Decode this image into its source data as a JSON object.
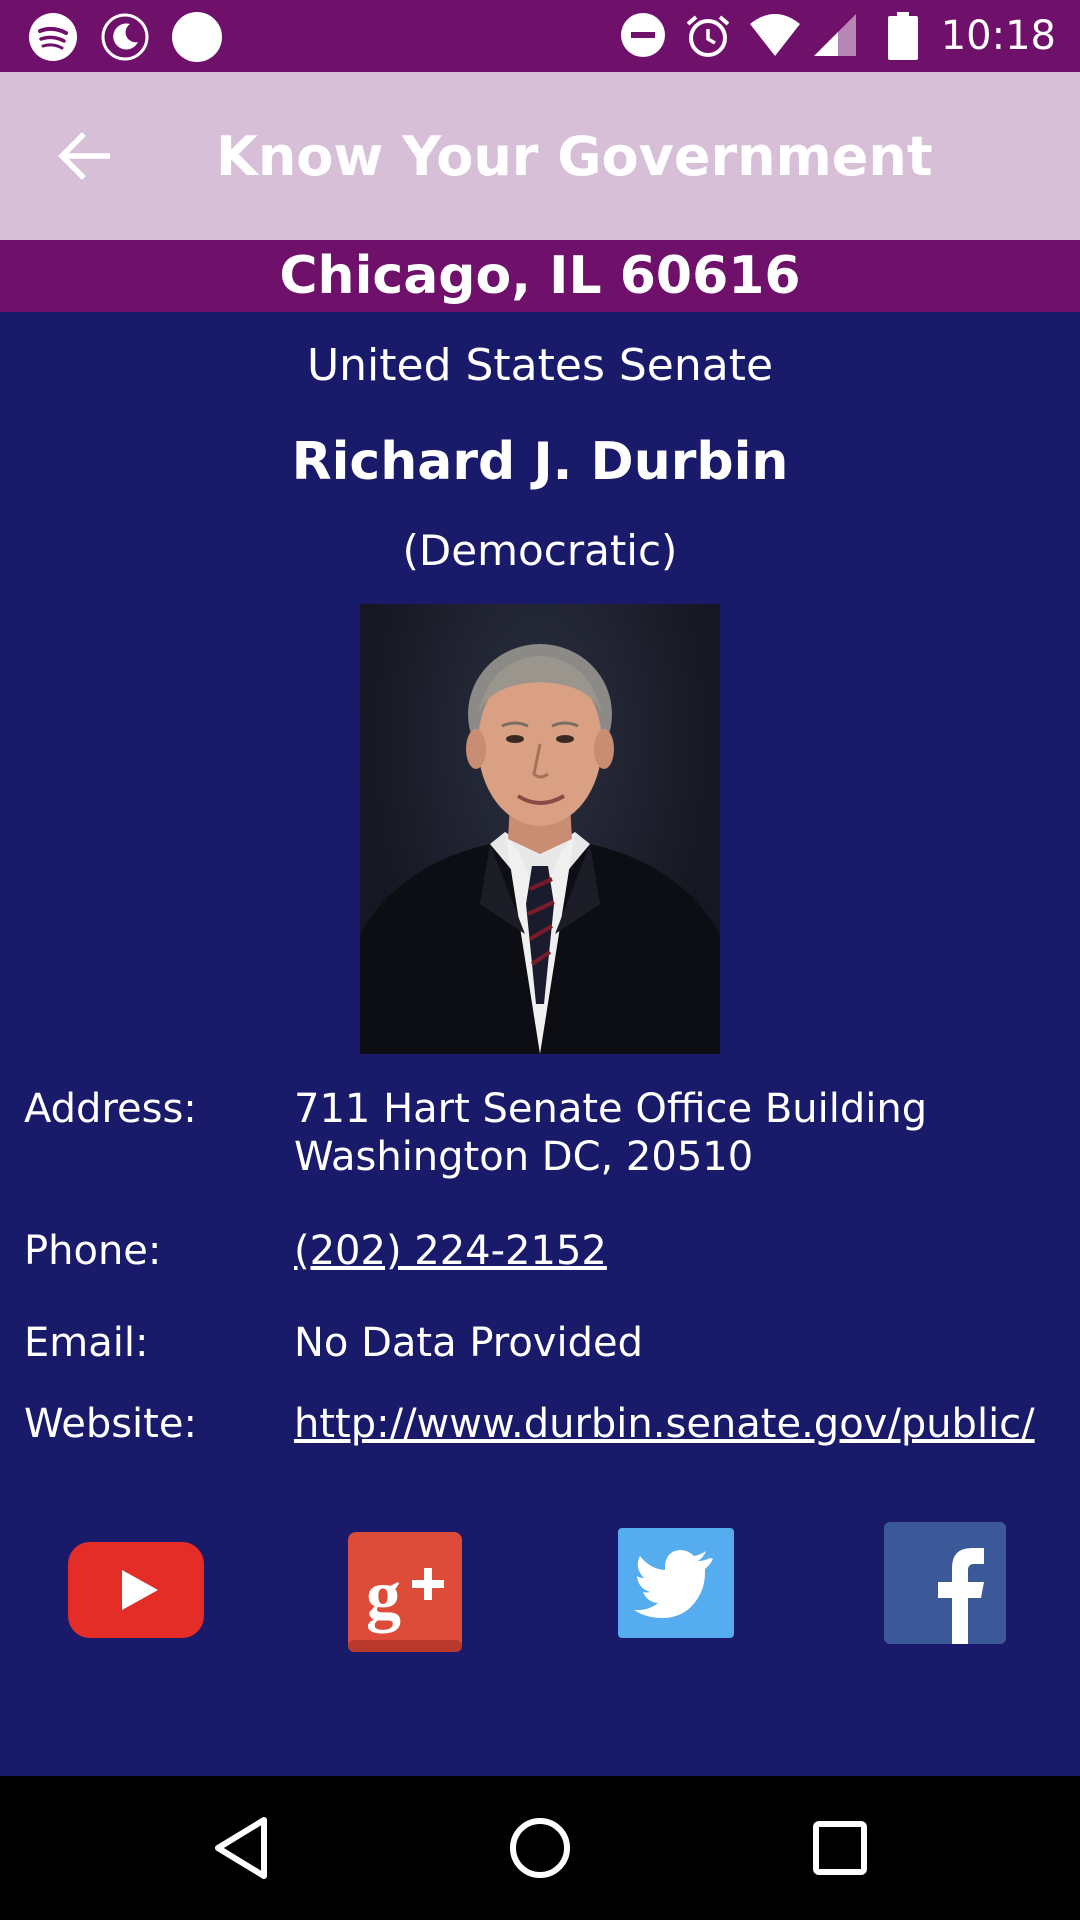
{
  "status_bar": {
    "time": "10:18",
    "left_icons": [
      "spotify-icon",
      "night-mode-icon",
      "circle-notification-icon"
    ],
    "right_icons": [
      "do-not-disturb-icon",
      "alarm-icon",
      "wifi-icon",
      "signal-icon",
      "battery-icon"
    ]
  },
  "app_bar": {
    "title": "Know Your Government",
    "back_icon": "arrow-back-icon",
    "background": "#d8bfd8"
  },
  "location": "Chicago, IL 60616",
  "official": {
    "office": "United States Senate",
    "name": "Richard J. Durbin",
    "party": "(Democratic)"
  },
  "details": {
    "address_label": "Address:",
    "address_line1": "711 Hart Senate Office Building",
    "address_line2": "Washington DC, 20510",
    "phone_label": "Phone:",
    "phone": "(202) 224-2152",
    "email_label": "Email:",
    "email": "No Data Provided",
    "website_label": "Website:",
    "website": "http://www.durbin.senate.gov/public/"
  },
  "social": [
    "youtube-icon",
    "google-plus-icon",
    "twitter-icon",
    "facebook-icon"
  ],
  "colors": {
    "primary_dark": "#6f106b",
    "background": "#1a1a6b",
    "youtube": "#e52d27",
    "google_plus": "#dd4b39",
    "twitter": "#55acee",
    "facebook": "#3b5998"
  },
  "nav_bar": [
    "back-nav-icon",
    "home-nav-icon",
    "recents-nav-icon"
  ]
}
